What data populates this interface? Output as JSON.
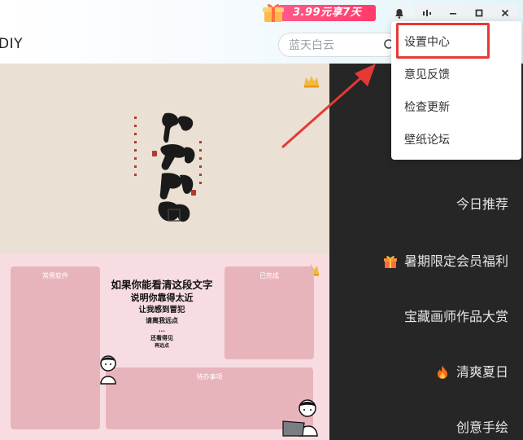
{
  "header": {
    "brand_suffix": "DIY",
    "promo_text": "3.99元享7天",
    "search": {
      "placeholder": "蓝天白云"
    }
  },
  "menu": {
    "items": [
      {
        "label": "设置中心",
        "highlighted": true
      },
      {
        "label": "意见反馈"
      },
      {
        "label": "检查更新"
      },
      {
        "label": "壁纸论坛"
      }
    ]
  },
  "wallpapers": {
    "bottom_panel": {
      "card_labels": [
        "常用软件",
        "已完成",
        "待办事项"
      ],
      "poem_lines": [
        "如果你能看清这段文字",
        "说明你靠得太近",
        "让我感到冒犯",
        "请离我远点",
        "...",
        "还看得见",
        "再远点"
      ]
    }
  },
  "categories": [
    {
      "label": "今日推荐",
      "icon": null
    },
    {
      "label": "暑期限定会员福利",
      "icon": "gift-icon"
    },
    {
      "label": "宝藏画师作品大赏",
      "icon": null
    },
    {
      "label": "清爽夏日",
      "icon": "fire-icon"
    },
    {
      "label": "创意手绘",
      "icon": null
    }
  ],
  "colors": {
    "accent_red": "#e53935",
    "promo_pink": "#ff3b6b",
    "side_panel": "#262626",
    "wall_top_bg": "#eae0d3",
    "wall_bottom_bg": "#f7dde2",
    "card_pink": "#e8b4bb"
  }
}
